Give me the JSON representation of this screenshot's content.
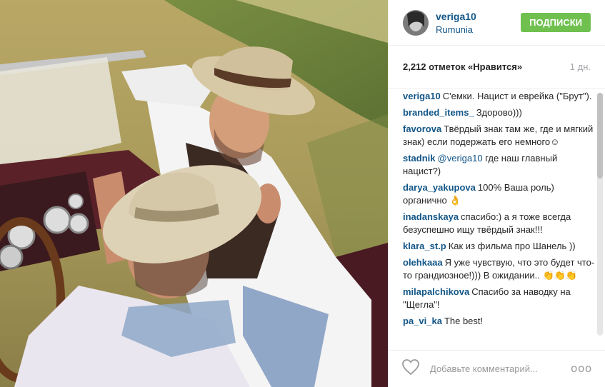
{
  "header": {
    "username": "veriga10",
    "location": "Rumunia",
    "follow_label": "ПОДПИСКИ"
  },
  "likes": {
    "count_label": "2,212 отметок «Нравится»",
    "time": "1 дн."
  },
  "comments": [
    {
      "user": "veriga10",
      "text": "С'емки. Нацист и еврейка (\"Брут\")."
    },
    {
      "user": "branded_items_",
      "text": "Здорово)))"
    },
    {
      "user": "favorova",
      "text": "Твёрдый знак там же, где и мягкий знак) если подержать его немного☺"
    },
    {
      "user": "stadnik",
      "mention": "@veriga10",
      "text": "где наш главный нацист?)"
    },
    {
      "user": "darya_yakupova",
      "text": "100% Ваша роль) органично 👌"
    },
    {
      "user": "inadanskaya",
      "text": "спасибо:) а я тоже всегда безуспешно ищу твёрдый знак!!!"
    },
    {
      "user": "klara_st.p",
      "text": "Как из фильма про Шанель ))"
    },
    {
      "user": "olehkaaa",
      "text": "Я уже чувствую, что это будет что-то грандиозное!))) В ожидании.. 👏👏👏"
    },
    {
      "user": "milapalchikova",
      "text": "Спасибо за наводку на \"Щегла\"!"
    },
    {
      "user": "pa_vi_ka",
      "text": "The best!"
    }
  ],
  "footer": {
    "comment_placeholder": "Добавьте комментарий...",
    "more_label": "ooo"
  },
  "icons": {
    "heart": "heart-icon",
    "more": "more-options-icon"
  },
  "colors": {
    "link_blue": "#125688",
    "follow_green": "#70c050",
    "text": "#262626",
    "muted": "#a5a7aa"
  }
}
